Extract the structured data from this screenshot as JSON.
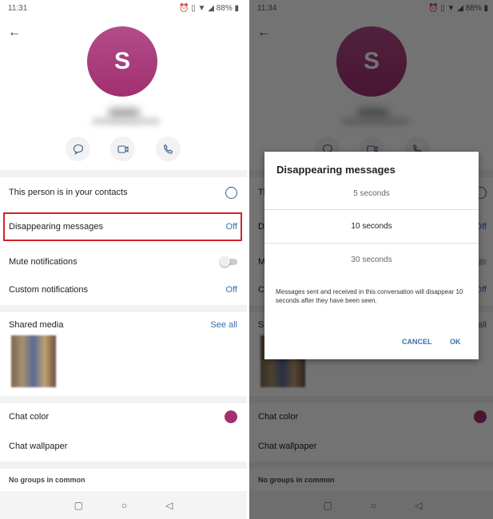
{
  "left": {
    "time": "11:31"
  },
  "right": {
    "time": "11:34"
  },
  "status": {
    "battery": "88%"
  },
  "profile": {
    "initial": "S"
  },
  "rows": {
    "contacts": "This person is in your contacts",
    "disappearing": "Disappearing messages",
    "disappearing_value": "Off",
    "mute": "Mute notifications",
    "custom": "Custom notifications",
    "custom_value": "Off",
    "shared_media": "Shared media",
    "see_all": "See all",
    "chat_color": "Chat color",
    "chat_wallpaper": "Chat wallpaper",
    "no_groups": "No groups in common"
  },
  "colors": {
    "accent": "#3a6fb0",
    "avatar": "#a2306f",
    "highlight": "#d0232a"
  },
  "dialog": {
    "title": "Disappearing messages",
    "options": [
      "5 seconds",
      "10 seconds",
      "30 seconds"
    ],
    "selected": "10 seconds",
    "description": "Messages sent and received in this conversation will disappear 10 seconds after they have been seen.",
    "cancel": "CANCEL",
    "ok": "OK"
  }
}
